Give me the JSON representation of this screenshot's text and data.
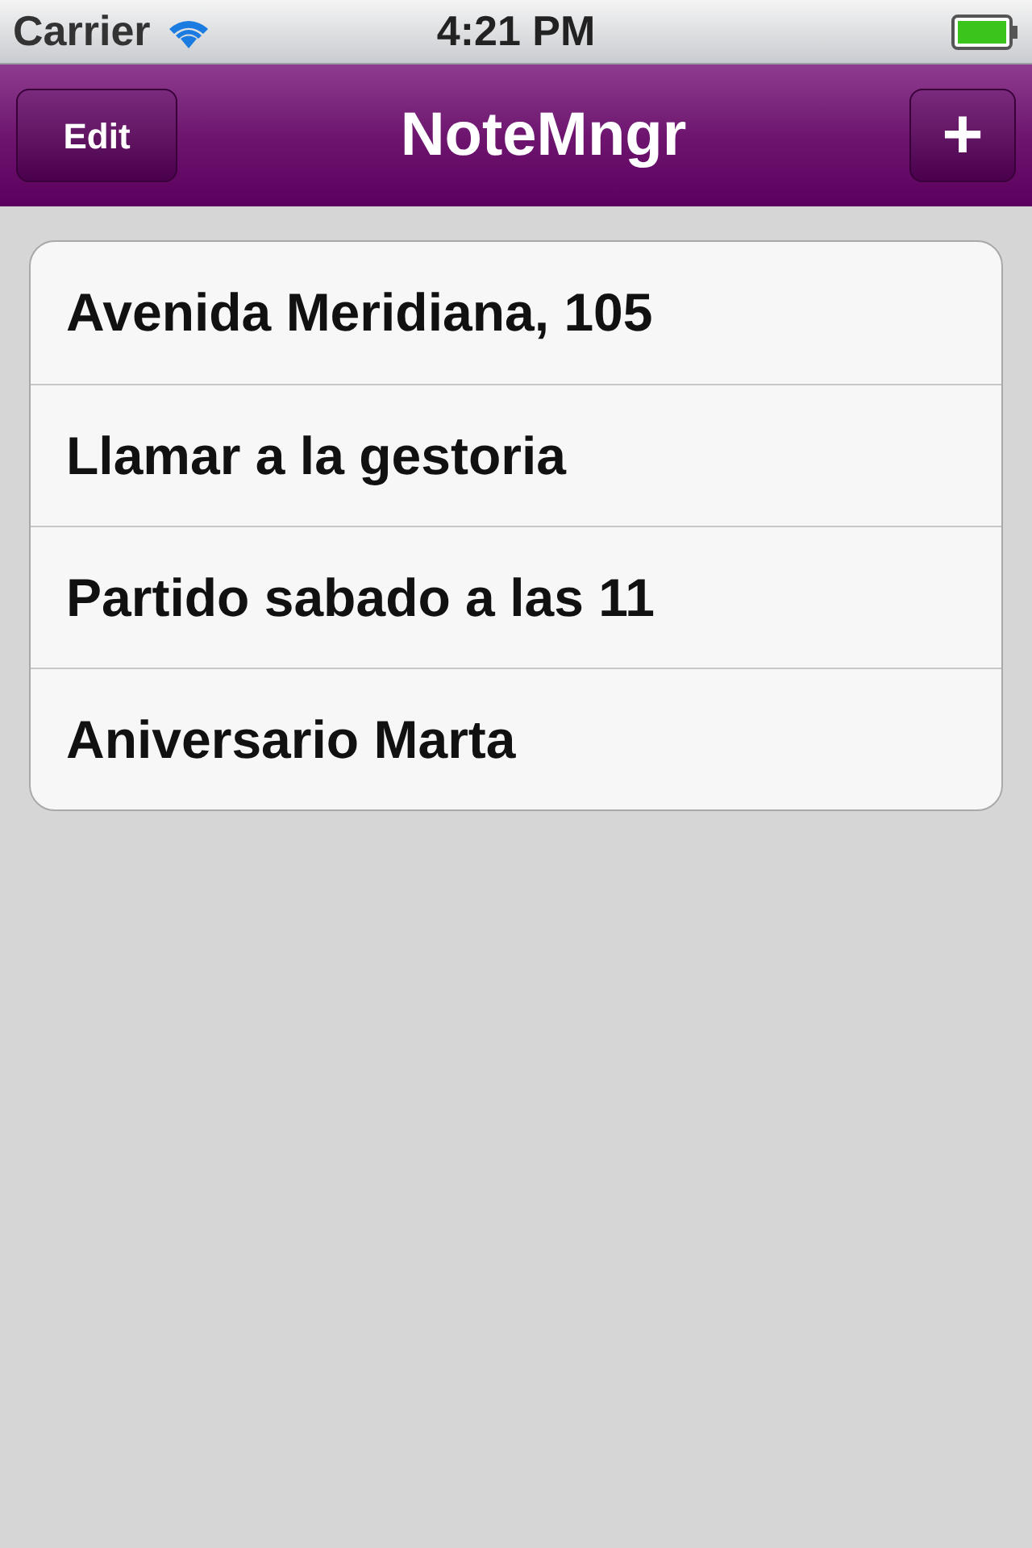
{
  "status_bar": {
    "carrier": "Carrier",
    "time": "4:21 PM"
  },
  "nav_bar": {
    "title": "NoteMngr",
    "left_button": "Edit",
    "right_button": "+"
  },
  "notes": [
    {
      "title": "Avenida Meridiana, 105"
    },
    {
      "title": "Llamar a la gestoria"
    },
    {
      "title": "Partido sabado a las 11"
    },
    {
      "title": "Aniversario Marta"
    }
  ]
}
